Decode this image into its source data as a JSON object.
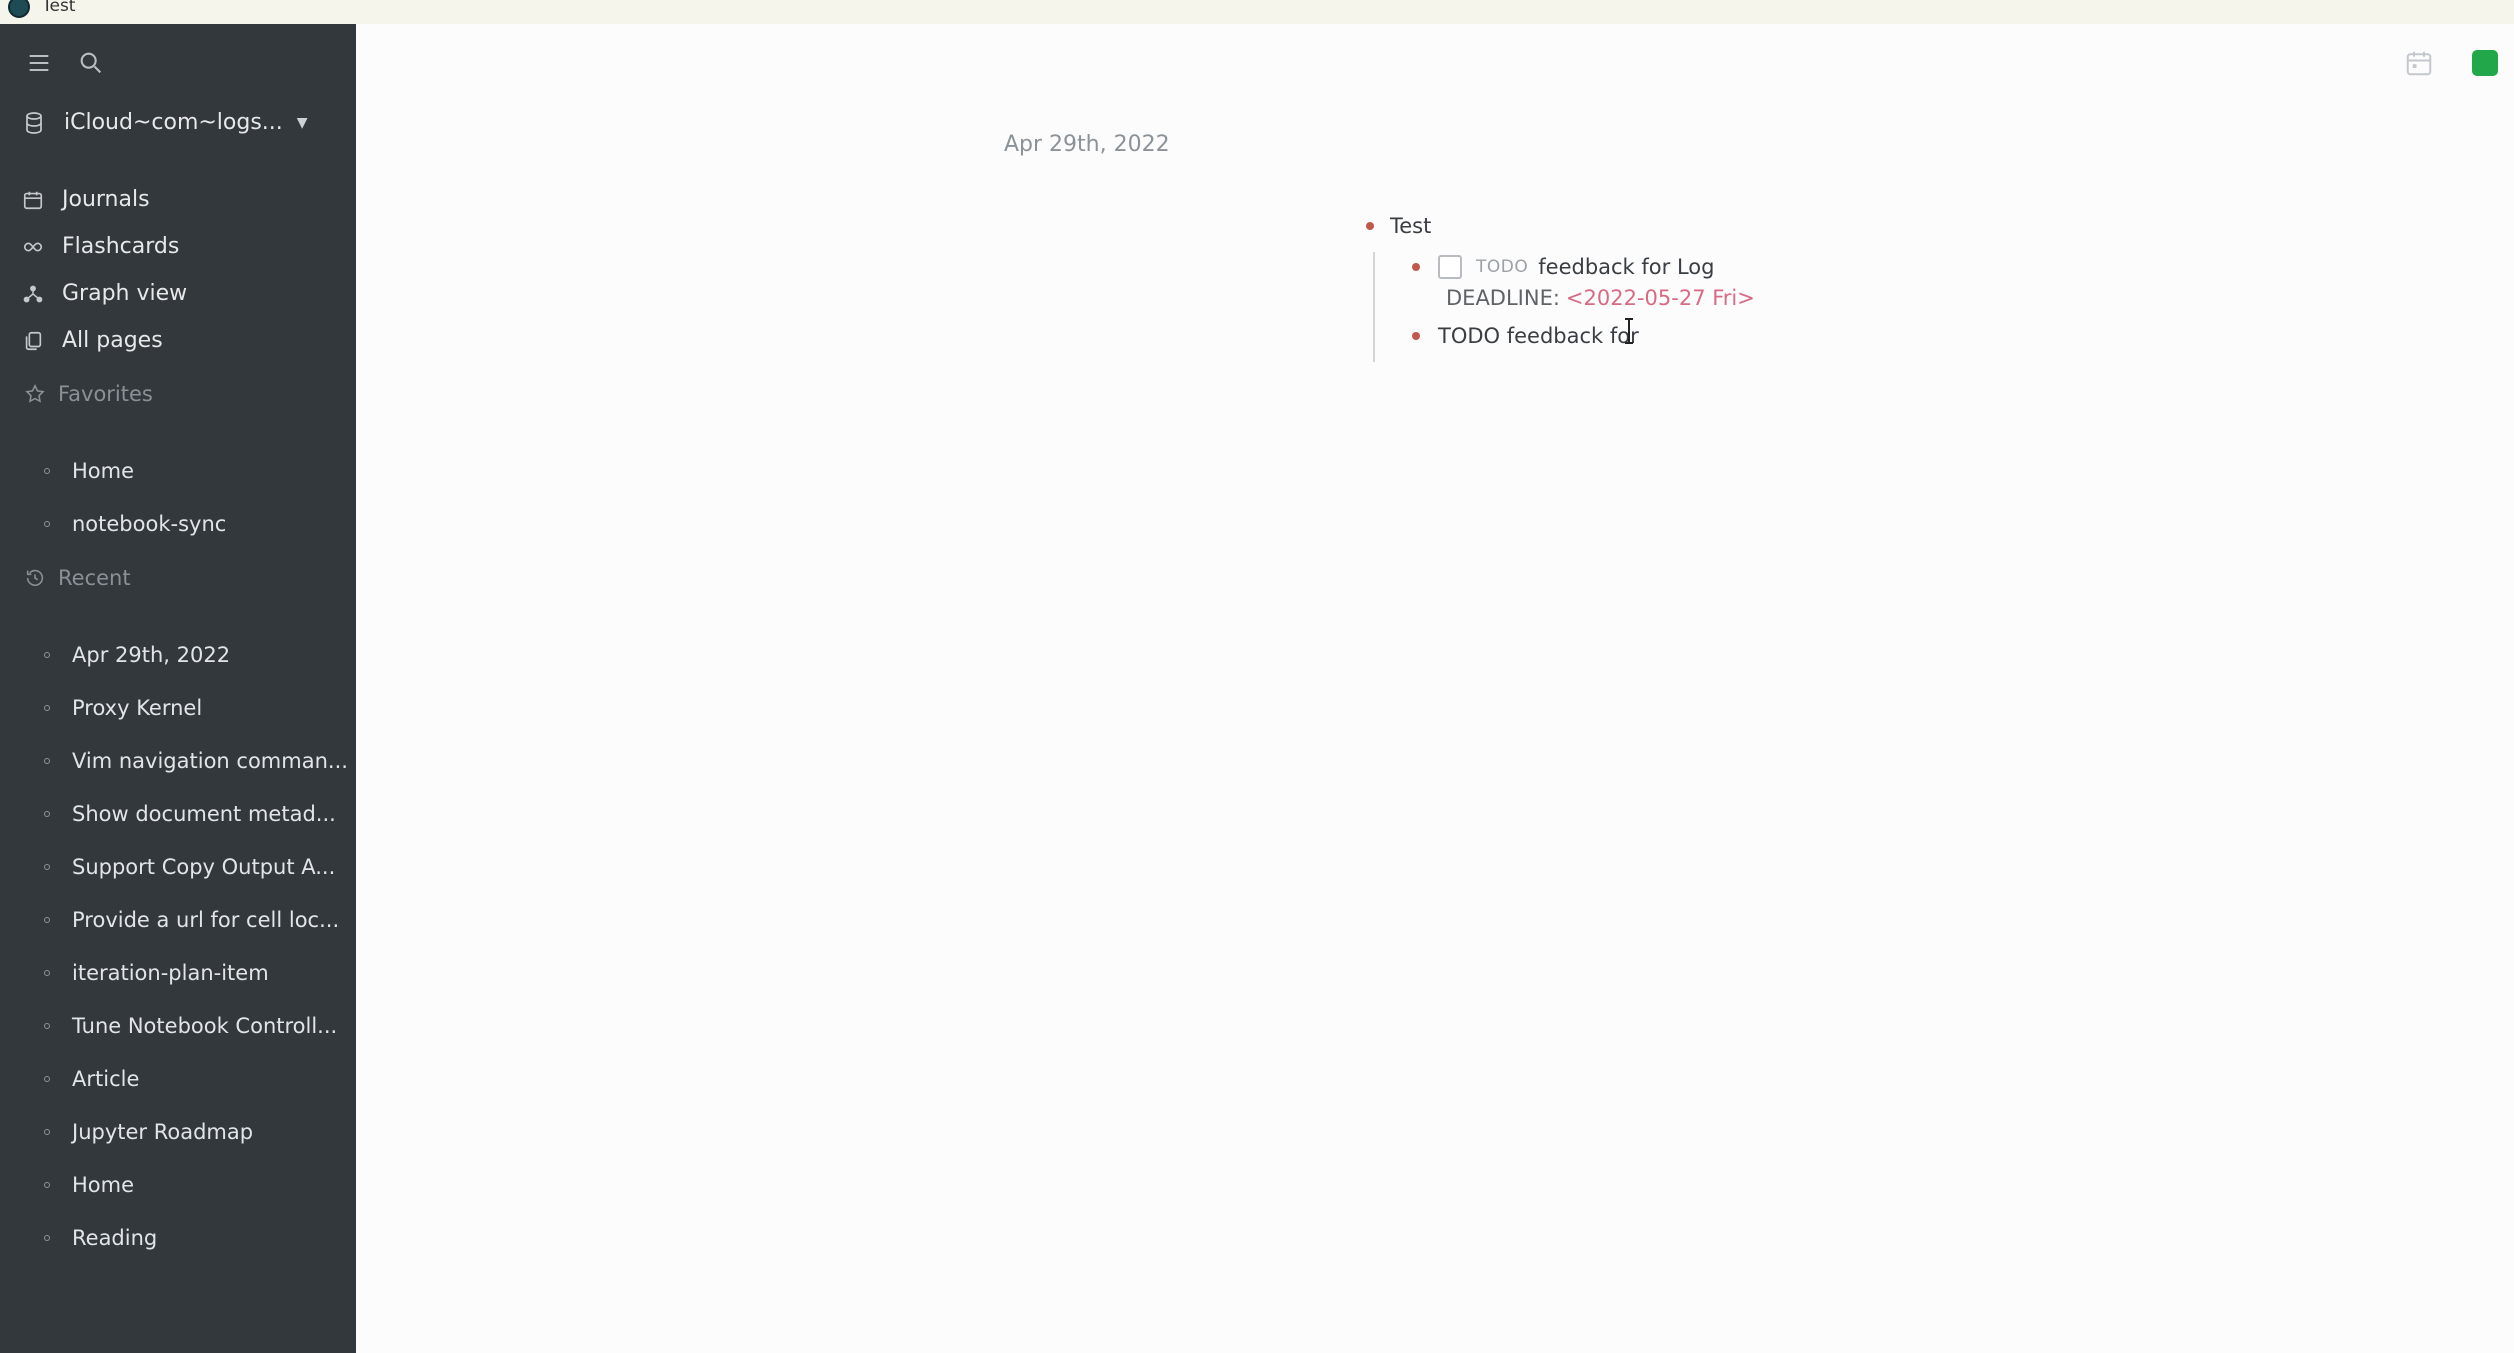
{
  "window": {
    "title": "Test"
  },
  "sidebar": {
    "repo_name": "iCloud~com~logs...",
    "nav": [
      {
        "label": "Journals",
        "icon": "calendar-icon"
      },
      {
        "label": "Flashcards",
        "icon": "infinity-icon"
      },
      {
        "label": "Graph view",
        "icon": "graph-icon"
      },
      {
        "label": "All pages",
        "icon": "pages-icon"
      }
    ],
    "favorites_title": "Favorites",
    "favorites": [
      "Home",
      "notebook-sync"
    ],
    "recent_title": "Recent",
    "recent": [
      "Apr 29th, 2022",
      "Proxy Kernel",
      "Vim navigation comman...",
      "Show document metad...",
      "Support Copy Output A...",
      "Provide a url for cell loc...",
      "iteration-plan-item",
      "Tune Notebook Controll...",
      "Article",
      "Jupyter Roadmap",
      "Home",
      "Reading"
    ]
  },
  "main": {
    "page_title": "Apr 29th, 2022",
    "block_parent": "Test",
    "todo_marker": "TODO",
    "todo_text": "feedback for Log",
    "deadline_label": "DEADLINE:",
    "deadline_value": "<2022-05-27 Fri>",
    "editing_text": "TODO feedback for"
  },
  "colors": {
    "sidebar_bg": "#33383d",
    "bullet": "#c0584b",
    "deadline": "#d86a83",
    "sync_indicator": "#22a84a"
  }
}
